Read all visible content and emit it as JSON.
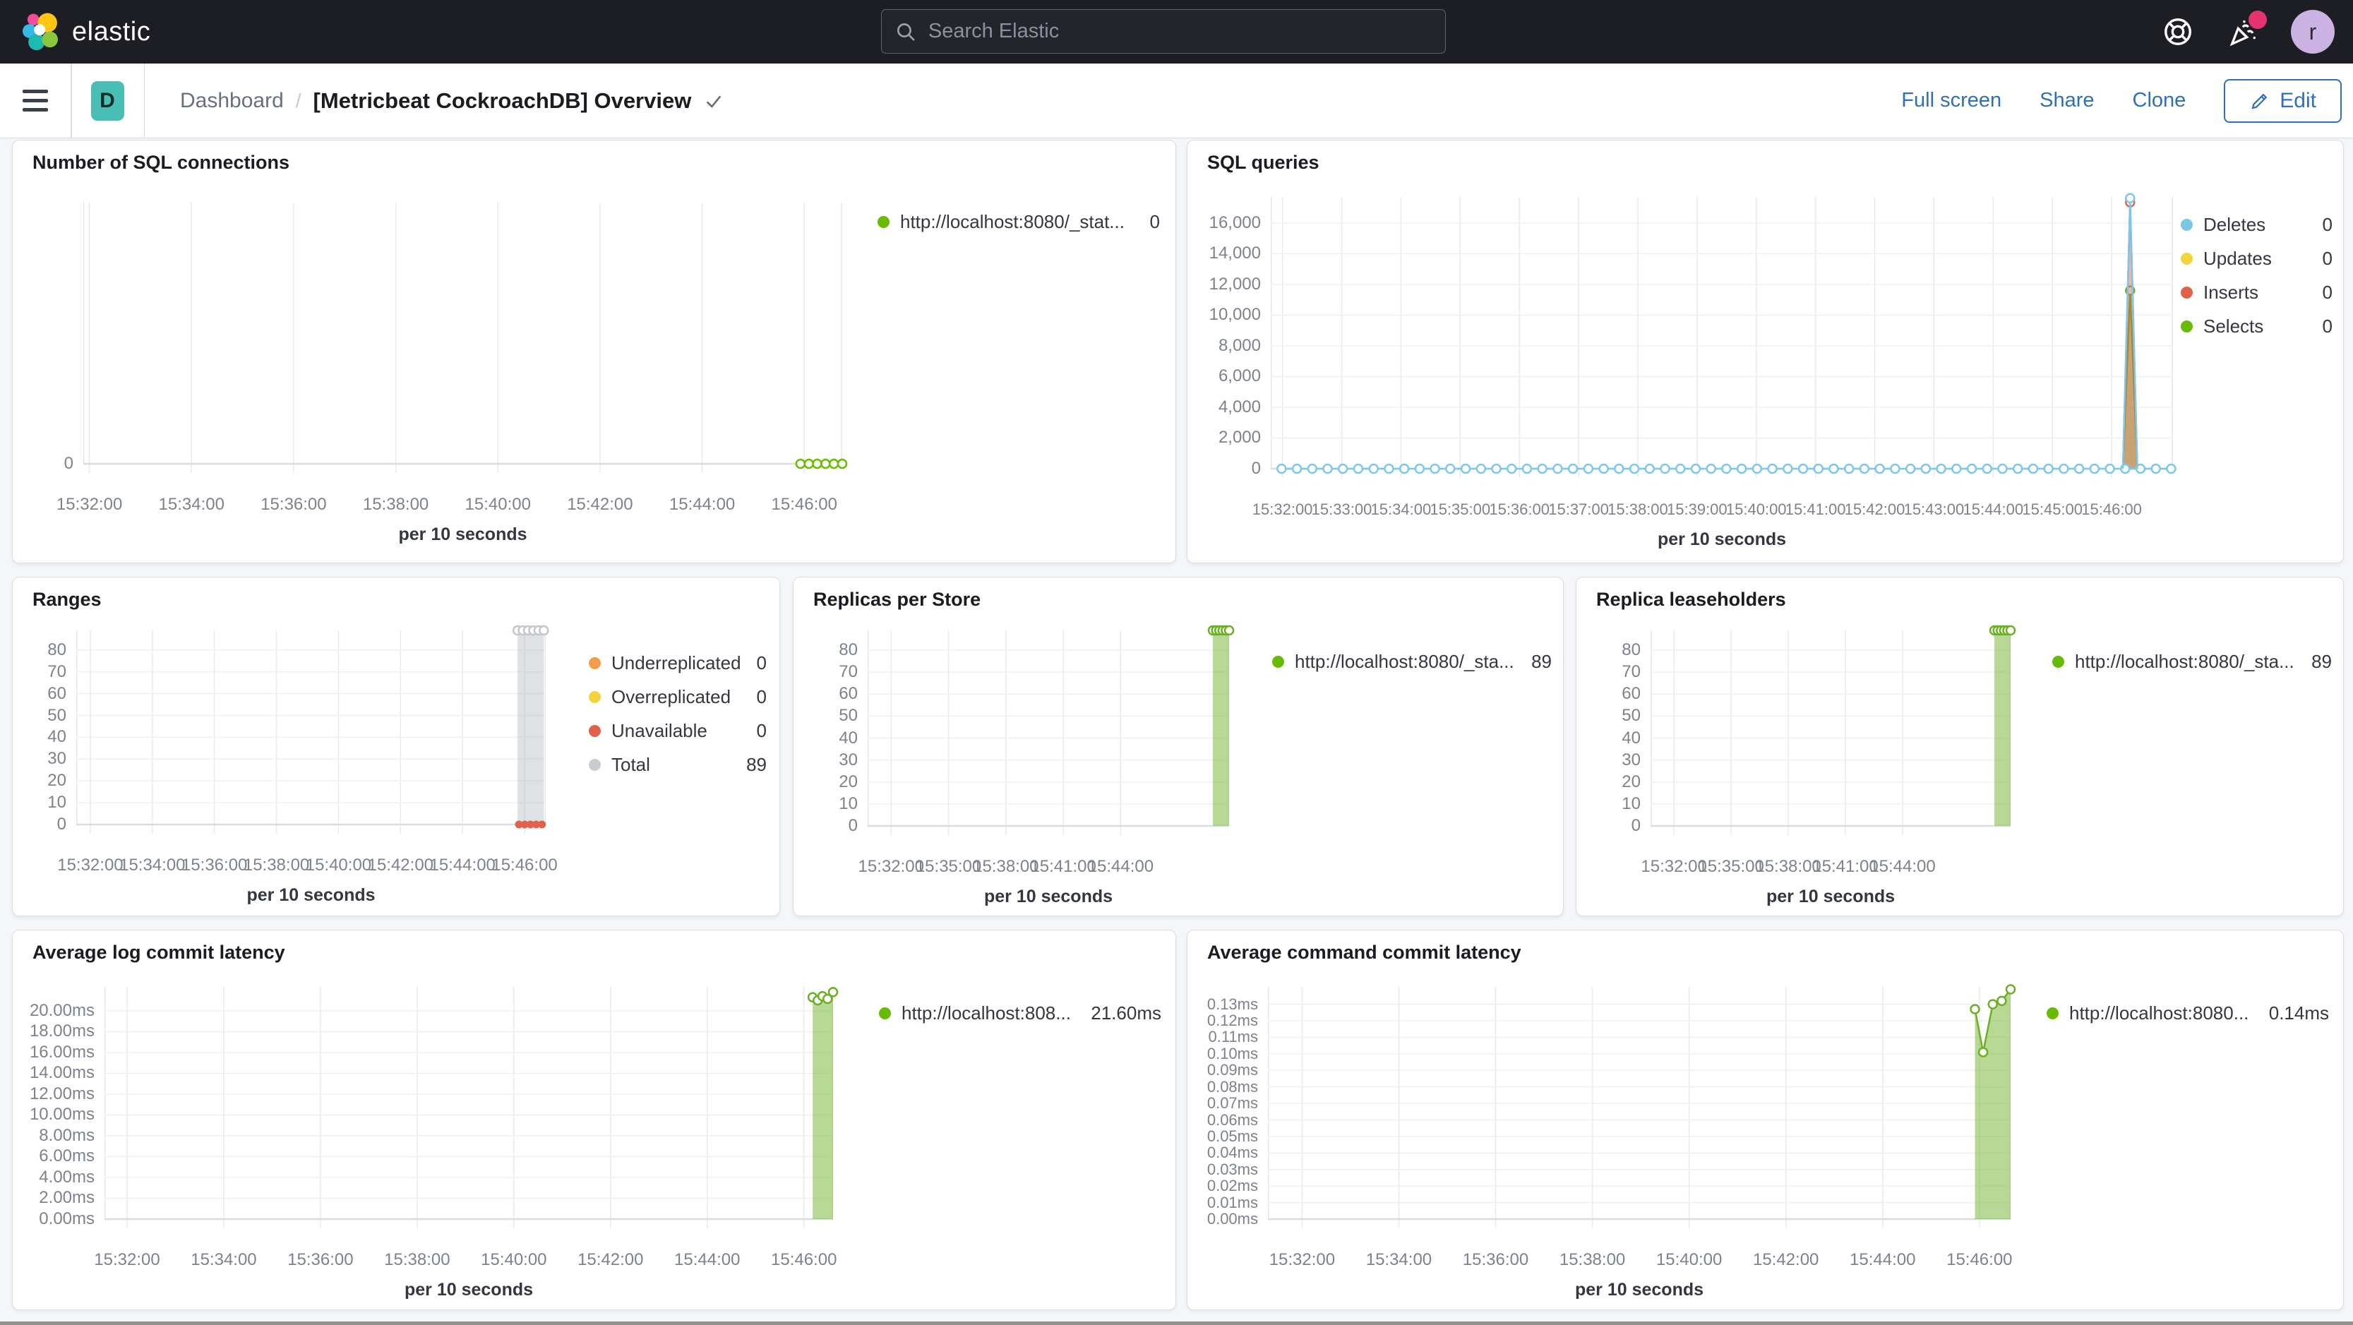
{
  "header": {
    "brand": "elastic",
    "search_placeholder": "Search Elastic",
    "avatar_initial": "r"
  },
  "breadcrumb": {
    "space_initial": "D",
    "section": "Dashboard",
    "separator": "/",
    "title": "[Metricbeat CockroachDB] Overview"
  },
  "toolbar": {
    "full_screen": "Full screen",
    "share": "Share",
    "clone": "Clone",
    "edit": "Edit"
  },
  "chart_data": [
    {
      "id": "sql-connections",
      "type": "line",
      "title": "Number of SQL connections",
      "x_axis_title": "per 10 seconds",
      "x_ticks": [
        "15:32:00",
        "15:34:00",
        "15:36:00",
        "15:38:00",
        "15:40:00",
        "15:42:00",
        "15:44:00",
        "15:46:00"
      ],
      "y_ticks": [
        {
          "label": "0",
          "value": 0
        }
      ],
      "ylim": [
        0,
        1
      ],
      "legend": [
        {
          "label": "http://localhost:8080/_stat...",
          "value": "0",
          "color": "#68BC00"
        }
      ],
      "series": [
        {
          "name": "http://localhost:8080/_stat...",
          "type": "flat",
          "color": "#68BC00",
          "value": 0,
          "from": 0.945,
          "to": 1.0,
          "n": 6
        }
      ]
    },
    {
      "id": "sql-queries",
      "type": "line",
      "title": "SQL queries",
      "x_axis_title": "per 10 seconds",
      "x_ticks": [
        "15:32:00",
        "15:33:00",
        "15:34:00",
        "15:35:00",
        "15:36:00",
        "15:37:00",
        "15:38:00",
        "15:39:00",
        "15:40:00",
        "15:41:00",
        "15:42:00",
        "15:43:00",
        "15:44:00",
        "15:45:00",
        "15:46:00"
      ],
      "y_ticks": [
        {
          "label": "0",
          "value": 0
        },
        {
          "label": "2,000",
          "value": 2000
        },
        {
          "label": "4,000",
          "value": 4000
        },
        {
          "label": "6,000",
          "value": 6000
        },
        {
          "label": "8,000",
          "value": 8000
        },
        {
          "label": "10,000",
          "value": 10000
        },
        {
          "label": "12,000",
          "value": 12000
        },
        {
          "label": "14,000",
          "value": 14000
        },
        {
          "label": "16,000",
          "value": 16000
        }
      ],
      "ylim": [
        0,
        17700
      ],
      "legend": [
        {
          "label": "Deletes",
          "value": "0",
          "color": "#79C7E3"
        },
        {
          "label": "Updates",
          "value": "0",
          "color": "#F2D53C"
        },
        {
          "label": "Inserts",
          "value": "0",
          "color": "#E0624C"
        },
        {
          "label": "Selects",
          "value": "0",
          "color": "#68BC00"
        }
      ],
      "series": [
        {
          "name": "Selects",
          "type": "area",
          "color": "#6AB023",
          "fill": "rgba(124,185,60,0.55)",
          "points": [
            [
              0.9445,
              0
            ],
            [
              0.9525,
              11600
            ],
            [
              0.9605,
              0
            ]
          ],
          "peak_marker": true
        },
        {
          "name": "Inserts",
          "type": "area",
          "color": "#E0624C",
          "fill": "rgba(224,98,76,0.45)",
          "points": [
            [
              0.9445,
              0
            ],
            [
              0.9525,
              17350
            ],
            [
              0.9605,
              0
            ]
          ],
          "peak_marker": true
        },
        {
          "name": "Deletes",
          "type": "flat",
          "color": "#7CC8EC",
          "value": 0,
          "from": 0.012,
          "to": 0.998,
          "n": 59
        },
        {
          "name": "Deletes",
          "type": "area",
          "color": "#7CC8EC",
          "fill": "none",
          "points": [
            [
              0.9445,
              0
            ],
            [
              0.9525,
              17620
            ],
            [
              0.9605,
              0
            ]
          ],
          "peak_marker": true
        }
      ]
    },
    {
      "id": "ranges",
      "type": "bar",
      "title": "Ranges",
      "x_axis_title": "per 10 seconds",
      "x_ticks": [
        "15:32:00",
        "15:34:00",
        "15:36:00",
        "15:38:00",
        "15:40:00",
        "15:42:00",
        "15:44:00",
        "15:46:00"
      ],
      "y_ticks": [
        {
          "label": "0",
          "value": 0
        },
        {
          "label": "10",
          "value": 10
        },
        {
          "label": "20",
          "value": 20
        },
        {
          "label": "30",
          "value": 30
        },
        {
          "label": "40",
          "value": 40
        },
        {
          "label": "50",
          "value": 50
        },
        {
          "label": "60",
          "value": 60
        },
        {
          "label": "70",
          "value": 70
        },
        {
          "label": "80",
          "value": 80
        }
      ],
      "ylim": [
        0,
        89
      ],
      "legend": [
        {
          "label": "Underreplicated",
          "value": "0",
          "color": "#F29D49"
        },
        {
          "label": "Overreplicated",
          "value": "0",
          "color": "#F2D53C"
        },
        {
          "label": "Unavailable",
          "value": "0",
          "color": "#E0624C"
        },
        {
          "label": "Total",
          "value": "89",
          "color": "#C9CDD3"
        }
      ],
      "series": [
        {
          "name": "Total",
          "type": "bar",
          "color": "#C2C6CD",
          "fill": "rgba(170,175,185,0.38)",
          "x0": 0.94,
          "x1": 0.996,
          "value": 89,
          "top_markers": 6
        },
        {
          "name": "Unavailable",
          "type": "flat",
          "color": "#E0624C",
          "value": 0,
          "from": 0.943,
          "to": 0.992,
          "n": 5,
          "solid": true
        }
      ]
    },
    {
      "id": "replicas-per-store",
      "type": "bar",
      "title": "Replicas per Store",
      "x_axis_title": "per 10 seconds",
      "x_ticks": [
        "15:32:00",
        "15:35:00",
        "15:38:00",
        "15:41:00",
        "15:44:00"
      ],
      "y_ticks": [
        {
          "label": "0",
          "value": 0
        },
        {
          "label": "10",
          "value": 10
        },
        {
          "label": "20",
          "value": 20
        },
        {
          "label": "30",
          "value": 30
        },
        {
          "label": "40",
          "value": 40
        },
        {
          "label": "50",
          "value": 50
        },
        {
          "label": "60",
          "value": 60
        },
        {
          "label": "70",
          "value": 70
        },
        {
          "label": "80",
          "value": 80
        }
      ],
      "ylim": [
        0,
        89
      ],
      "legend": [
        {
          "label": "http://localhost:8080/_sta...",
          "value": "89",
          "color": "#68BC00"
        }
      ],
      "series": [
        {
          "name": "http://localhost:8080/_sta...",
          "type": "bar",
          "color": "#6AB023",
          "fill": "rgba(124,185,60,0.55)",
          "x0": 0.955,
          "x1": 1.0,
          "value": 89,
          "top_markers": 6
        }
      ]
    },
    {
      "id": "replica-leaseholders",
      "type": "bar",
      "title": "Replica leaseholders",
      "x_axis_title": "per 10 seconds",
      "x_ticks": [
        "15:32:00",
        "15:35:00",
        "15:38:00",
        "15:41:00",
        "15:44:00"
      ],
      "y_ticks": [
        {
          "label": "0",
          "value": 0
        },
        {
          "label": "10",
          "value": 10
        },
        {
          "label": "20",
          "value": 20
        },
        {
          "label": "30",
          "value": 30
        },
        {
          "label": "40",
          "value": 40
        },
        {
          "label": "50",
          "value": 50
        },
        {
          "label": "60",
          "value": 60
        },
        {
          "label": "70",
          "value": 70
        },
        {
          "label": "80",
          "value": 80
        }
      ],
      "ylim": [
        0,
        89
      ],
      "legend": [
        {
          "label": "http://localhost:8080/_sta...",
          "value": "89",
          "color": "#68BC00"
        }
      ],
      "series": [
        {
          "name": "http://localhost:8080/_sta...",
          "type": "bar",
          "color": "#6AB023",
          "fill": "rgba(124,185,60,0.55)",
          "x0": 0.955,
          "x1": 1.0,
          "value": 89,
          "top_markers": 6
        }
      ]
    },
    {
      "id": "avg-log-commit-latency",
      "type": "area",
      "title": "Average log commit latency",
      "x_axis_title": "per 10 seconds",
      "x_ticks": [
        "15:32:00",
        "15:34:00",
        "15:36:00",
        "15:38:00",
        "15:40:00",
        "15:42:00",
        "15:44:00",
        "15:46:00"
      ],
      "y_ticks": [
        {
          "label": "0.00ms",
          "value": 0
        },
        {
          "label": "2.00ms",
          "value": 2
        },
        {
          "label": "4.00ms",
          "value": 4
        },
        {
          "label": "6.00ms",
          "value": 6
        },
        {
          "label": "8.00ms",
          "value": 8
        },
        {
          "label": "10.00ms",
          "value": 10
        },
        {
          "label": "12.00ms",
          "value": 12
        },
        {
          "label": "14.00ms",
          "value": 14
        },
        {
          "label": "16.00ms",
          "value": 16
        },
        {
          "label": "18.00ms",
          "value": 18
        },
        {
          "label": "20.00ms",
          "value": 20
        }
      ],
      "ylim": [
        0,
        22.3
      ],
      "legend": [
        {
          "label": "http://localhost:808...",
          "value": "21.60ms",
          "color": "#68BC00"
        }
      ],
      "series": [
        {
          "name": "http://localhost:808...",
          "type": "area",
          "color": "#6AB023",
          "fill": "rgba(124,185,60,0.55)",
          "points": [
            [
              0.972,
              21.3
            ],
            [
              0.979,
              21.0
            ],
            [
              0.9855,
              21.4
            ],
            [
              0.9925,
              21.15
            ],
            [
              1.0,
              21.8
            ]
          ],
          "markers": "all"
        }
      ]
    },
    {
      "id": "avg-command-commit-latency",
      "type": "area",
      "title": "Average command commit latency",
      "x_axis_title": "per 10 seconds",
      "x_ticks": [
        "15:32:00",
        "15:34:00",
        "15:36:00",
        "15:38:00",
        "15:40:00",
        "15:42:00",
        "15:44:00",
        "15:46:00"
      ],
      "y_ticks": [
        {
          "label": "0.00ms",
          "value": 0
        },
        {
          "label": "0.01ms",
          "value": 0.01
        },
        {
          "label": "0.02ms",
          "value": 0.02
        },
        {
          "label": "0.03ms",
          "value": 0.03
        },
        {
          "label": "0.04ms",
          "value": 0.04
        },
        {
          "label": "0.05ms",
          "value": 0.05
        },
        {
          "label": "0.06ms",
          "value": 0.06
        },
        {
          "label": "0.07ms",
          "value": 0.07
        },
        {
          "label": "0.08ms",
          "value": 0.08
        },
        {
          "label": "0.09ms",
          "value": 0.09
        },
        {
          "label": "0.10ms",
          "value": 0.1
        },
        {
          "label": "0.11ms",
          "value": 0.11
        },
        {
          "label": "0.12ms",
          "value": 0.12
        },
        {
          "label": "0.13ms",
          "value": 0.13
        }
      ],
      "ylim": [
        0,
        0.1405
      ],
      "legend": [
        {
          "label": "http://localhost:8080...",
          "value": "0.14ms",
          "color": "#68BC00"
        }
      ],
      "series": [
        {
          "name": "http://localhost:8080...",
          "type": "area",
          "color": "#6AB023",
          "fill": "rgba(124,185,60,0.55)",
          "points": [
            [
              0.952,
              0.127
            ],
            [
              0.963,
              0.101
            ],
            [
              0.976,
              0.13
            ],
            [
              0.988,
              0.132
            ],
            [
              1.0,
              0.139
            ]
          ],
          "markers": "all"
        }
      ]
    }
  ]
}
